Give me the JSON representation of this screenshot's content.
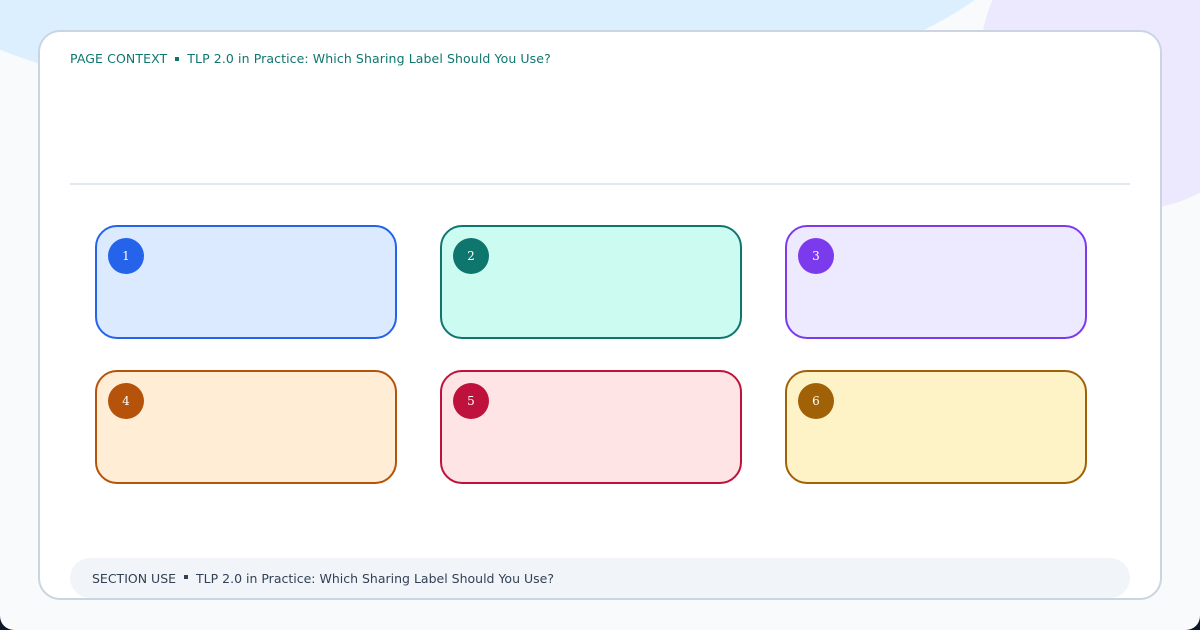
{
  "context_bar": {
    "label": "PAGE CONTEXT",
    "title": "TLP 2.0 in Practice: Which Sharing Label Should You Use?"
  },
  "boxes": [
    {
      "number": "1",
      "fill": "#dbeafe",
      "accent": "#2563eb"
    },
    {
      "number": "2",
      "fill": "#ccfbf1",
      "accent": "#0f766e"
    },
    {
      "number": "3",
      "fill": "#ede9fe",
      "accent": "#7c3aed"
    },
    {
      "number": "4",
      "fill": "#ffedd5",
      "accent": "#b45309"
    },
    {
      "number": "5",
      "fill": "#ffe4e6",
      "accent": "#be123c"
    },
    {
      "number": "6",
      "fill": "#fef3c7",
      "accent": "#a16207"
    }
  ],
  "footer": {
    "label": "SECTION USE",
    "title": "TLP 2.0 in Practice: Which Sharing Label Should You Use?"
  }
}
